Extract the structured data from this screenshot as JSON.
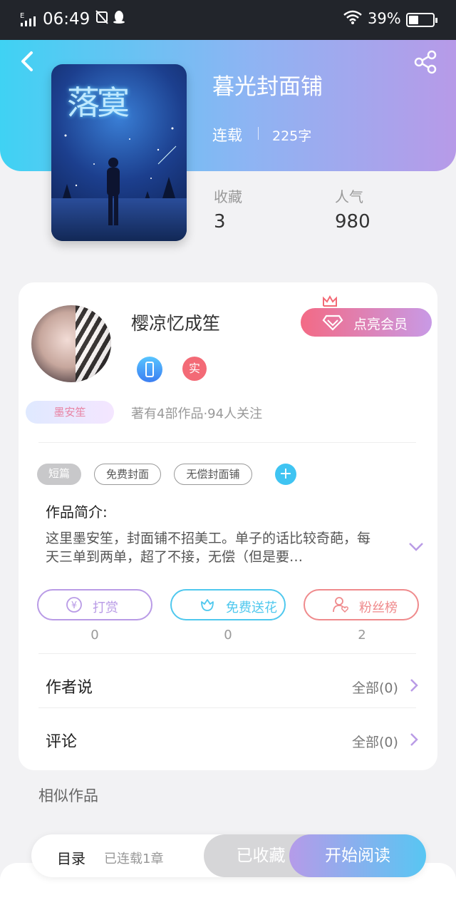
{
  "status_bar": {
    "time": "06:49",
    "network": "E",
    "battery": "39%"
  },
  "book": {
    "title": "暮光封面铺",
    "status": "连载",
    "words": "225字",
    "cover_title": "落寞"
  },
  "stats": [
    {
      "label": "收藏",
      "value": "3"
    },
    {
      "label": "人气",
      "value": "980"
    }
  ],
  "author": {
    "name": "樱凉忆成笙",
    "tag": "墨安笙",
    "badge_real": "实",
    "meta": "著有4部作品·94人关注"
  },
  "vip": {
    "label": "点亮会员"
  },
  "tags": [
    "短篇",
    "免费封面",
    "无偿封面铺"
  ],
  "intro": {
    "title": "作品简介:",
    "body": "这里墨安笙，封面铺不招美工。单子的话比较奇葩，每天三单到两单，超了不接，无偿（但是要…"
  },
  "actions": [
    {
      "label": "打赏",
      "count": "0",
      "color": "#b99be6"
    },
    {
      "label": "免费送花",
      "count": "0",
      "color": "#4fc8ee"
    },
    {
      "label": "粉丝榜",
      "count": "2",
      "color": "#ef8a8c"
    }
  ],
  "author_says": {
    "label": "作者说",
    "link": "全部(0)"
  },
  "comments": {
    "label": "评论",
    "link": "全部(0)"
  },
  "similar": {
    "title": "相似作品"
  },
  "bottom_bar": {
    "toc": "目录",
    "toc_meta": "已连载1章",
    "collected": "已收藏",
    "read": "开始阅读"
  },
  "colors": {
    "accent_cyan": "#3fd2f3",
    "accent_purple": "#b79ae8",
    "vip": "#f36a85"
  }
}
